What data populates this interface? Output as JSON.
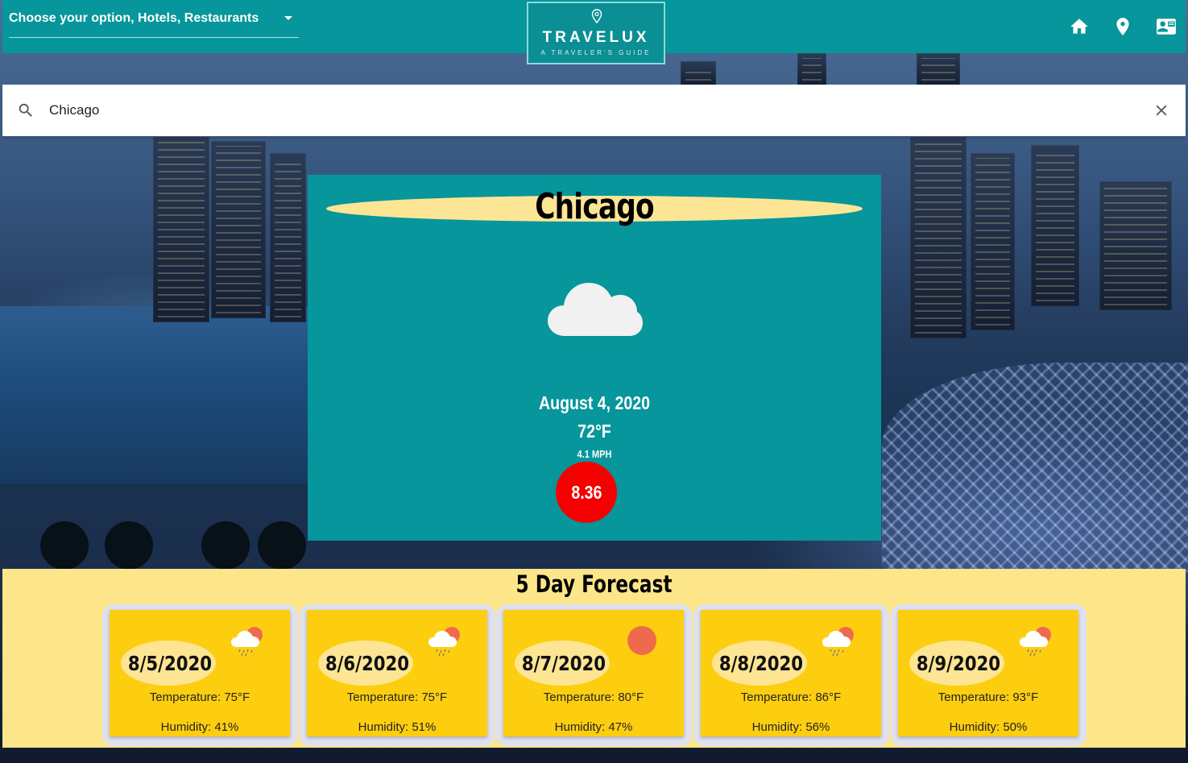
{
  "header": {
    "option_select": "Choose your option, Hotels, Restaurants",
    "logo_title": "TRAVELUX",
    "logo_subtitle": "A TRAVELER'S GUIDE",
    "nav_icons": [
      "home-icon",
      "pin-icon",
      "contact-card-icon"
    ]
  },
  "search": {
    "value": "Chicago",
    "icon": "search-icon",
    "clear_icon": "close-icon"
  },
  "current": {
    "city": "Chicago",
    "icon": "cloud-icon",
    "date": "August 4, 2020",
    "temperature": "72°F",
    "wind": "4.1 MPH",
    "uv_index": "8.36",
    "uv_color": "#f50000"
  },
  "forecast": {
    "title": "5 Day Forecast",
    "days": [
      {
        "date": "8/5/2020",
        "icon": "rain-icon",
        "temperature": "Temperature: 75°F",
        "humidity": "Humidity: 41%"
      },
      {
        "date": "8/6/2020",
        "icon": "rain-icon",
        "temperature": "Temperature: 75°F",
        "humidity": "Humidity: 51%"
      },
      {
        "date": "8/7/2020",
        "icon": "sun-icon",
        "temperature": "Temperature: 80°F",
        "humidity": "Humidity: 47%"
      },
      {
        "date": "8/8/2020",
        "icon": "rain-icon",
        "temperature": "Temperature: 86°F",
        "humidity": "Humidity: 56%"
      },
      {
        "date": "8/9/2020",
        "icon": "rain-icon",
        "temperature": "Temperature: 93°F",
        "humidity": "Humidity: 50%"
      }
    ]
  },
  "colors": {
    "header": "#06969b",
    "forecast_bg": "#fde689",
    "card": "#fdce10",
    "title_highlight": "#fde596"
  }
}
